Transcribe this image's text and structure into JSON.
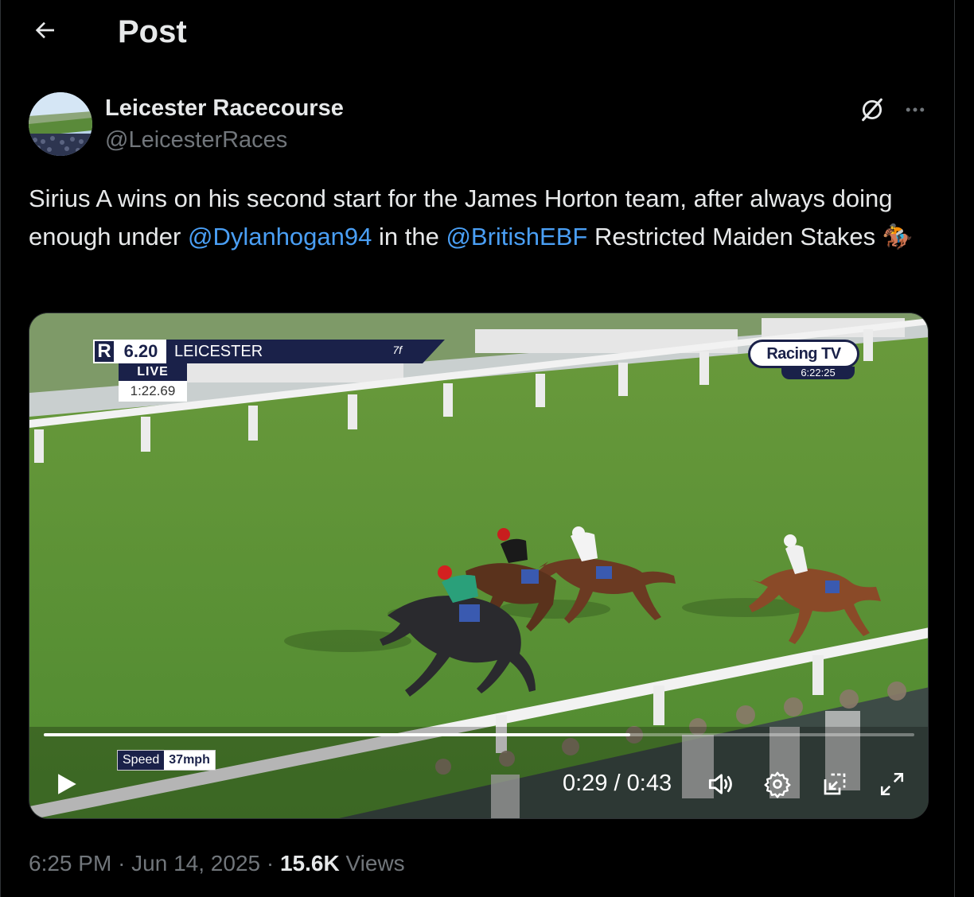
{
  "header": {
    "title": "Post"
  },
  "author": {
    "display_name": "Leicester Racecourse",
    "handle": "@LeicesterRaces"
  },
  "tweet": {
    "text_part1": "Sirius A wins on his second start for the James Horton team, after always doing enough under ",
    "mention1": "@Dylanhogan94",
    "text_part2": " in the ",
    "mention2": "@BritishEBF",
    "text_part3": " Restricted Maiden Stakes ",
    "emoji": "🏇"
  },
  "video": {
    "overlay": {
      "race_time": "6.20",
      "course": "LEICESTER",
      "distance": "7f",
      "status": "LIVE",
      "elapsed": "1:22.69",
      "broadcaster": "Racing TV",
      "clock": "6:22:25",
      "speed_label": "Speed",
      "speed_value": "37mph"
    },
    "current_time": "0:29",
    "separator": "/",
    "duration": "0:43",
    "progress_fraction": 0.674
  },
  "meta": {
    "time": "6:25 PM",
    "dot1": "·",
    "date": "Jun 14, 2025",
    "dot2": "·",
    "views_count": "15.6K",
    "views_label": "Views"
  },
  "icons": [
    "back-arrow-icon",
    "grok-icon",
    "more-icon",
    "play-icon",
    "volume-icon",
    "settings-icon",
    "pip-icon",
    "fullscreen-icon"
  ]
}
